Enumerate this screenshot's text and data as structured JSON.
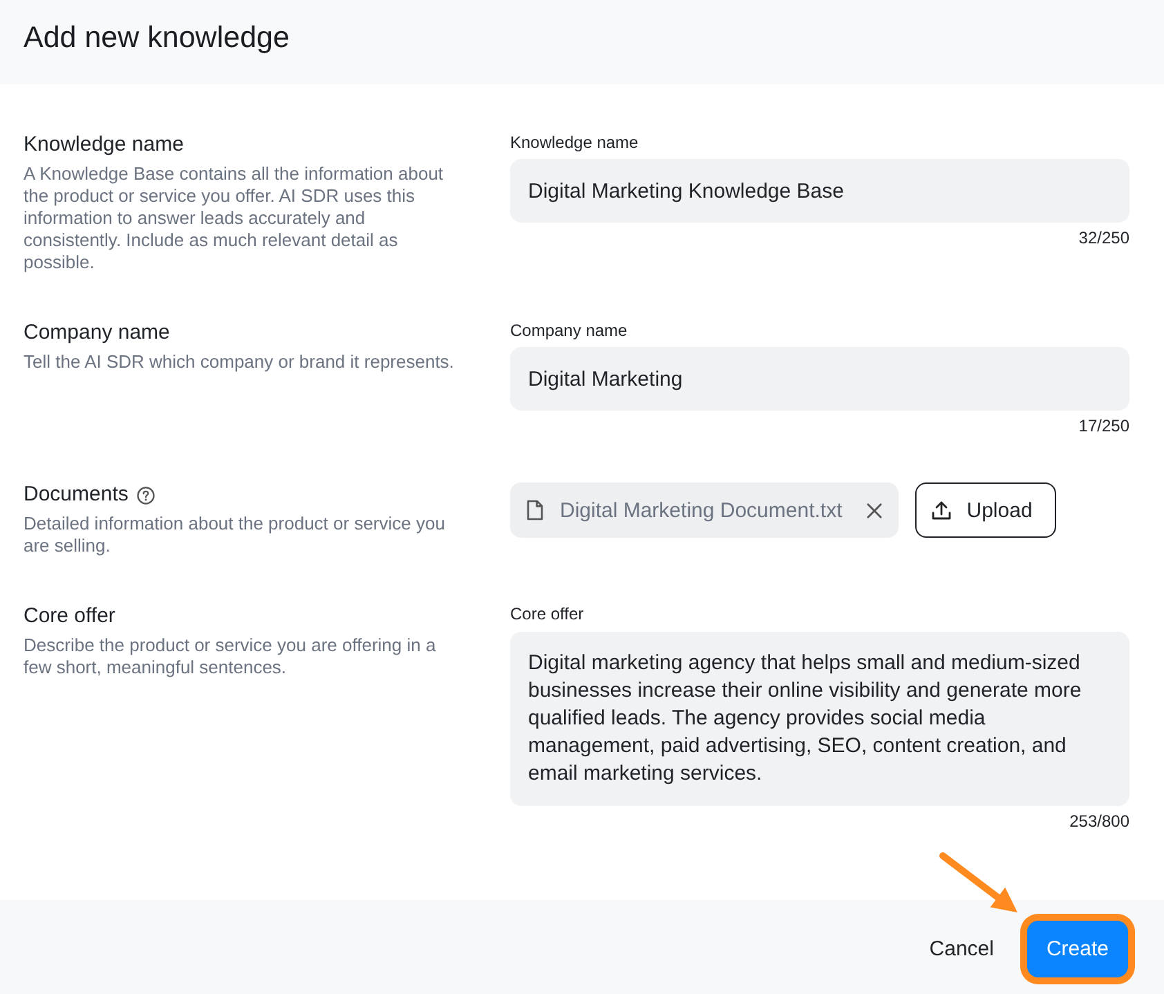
{
  "dialog": {
    "title": "Add new knowledge"
  },
  "sections": [
    {
      "kind": "text",
      "label": "Knowledge name",
      "help": false,
      "description": "A Knowledge Base contains all the information about the product or service you offer. AI SDR uses this information to answer leads accurately and consistently. Include as much relevant detail as possible.",
      "field": {
        "label": "Knowledge name",
        "value": "Digital Marketing Knowledge Base",
        "counter": "32/250"
      }
    },
    {
      "kind": "text",
      "label": "Company name",
      "help": false,
      "description": "Tell the AI SDR which company or brand it represents.",
      "field": {
        "label": "Company name",
        "value": "Digital Marketing",
        "counter": "17/250"
      }
    },
    {
      "kind": "files",
      "label": "Documents",
      "help": true,
      "description": "Detailed information about the product or service you are selling.",
      "files": [
        {
          "name": "Digital Marketing Document.txt"
        }
      ],
      "upload_button": "Upload"
    },
    {
      "kind": "textarea",
      "label": "Core offer",
      "help": false,
      "description": "Describe the product or service you are offering in a few short, meaningful sentences.",
      "field": {
        "label": "Core offer",
        "value": "Digital marketing agency that helps small and medium-sized businesses increase their online visibility and generate more qualified leads. The agency provides social media management, paid advertising, SEO, content creation, and email marketing services.",
        "counter": "253/800"
      }
    }
  ],
  "footer": {
    "buttons": [
      {
        "label": "Cancel",
        "kind": "secondary",
        "highlighted": false
      },
      {
        "label": "Create",
        "kind": "primary",
        "highlighted": true
      }
    ]
  }
}
